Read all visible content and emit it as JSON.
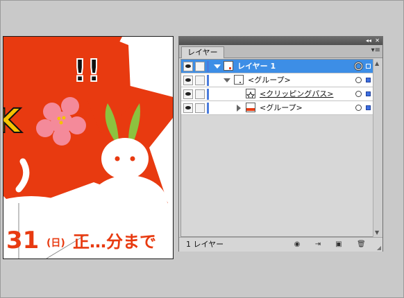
{
  "panel": {
    "tab_label": "レイヤー",
    "layer_count_text": "1 レイヤー"
  },
  "layers": [
    {
      "name": "レイヤー 1",
      "selected": true,
      "expanded": true
    },
    {
      "name": "<グループ>",
      "expanded": true
    },
    {
      "name": "<クリッピングパス>",
      "underlined": true
    },
    {
      "name": "<グループ>",
      "expanded": false
    }
  ],
  "artwork": {
    "exclamation_text": "!!",
    "left_letter_fragment": "K",
    "bottom_text_number": "31",
    "bottom_text_paren": "(日)",
    "bottom_text_rest": "正…分まで",
    "star_color": "#e83a10",
    "flower_color": "#f48a9a",
    "accent_yellow": "#f6c200"
  },
  "colors": {
    "selection_blue": "#3d8ee6",
    "layer_color_bar": "#4a7bdc"
  },
  "icons": {
    "collapse": "double-chevron-icon",
    "close": "close-icon",
    "panel_menu": "panel-menu-icon",
    "visibility": "eye-icon",
    "footer": [
      "make-clipping-mask-icon",
      "create-sublayer-icon",
      "create-layer-icon",
      "delete-icon"
    ]
  }
}
